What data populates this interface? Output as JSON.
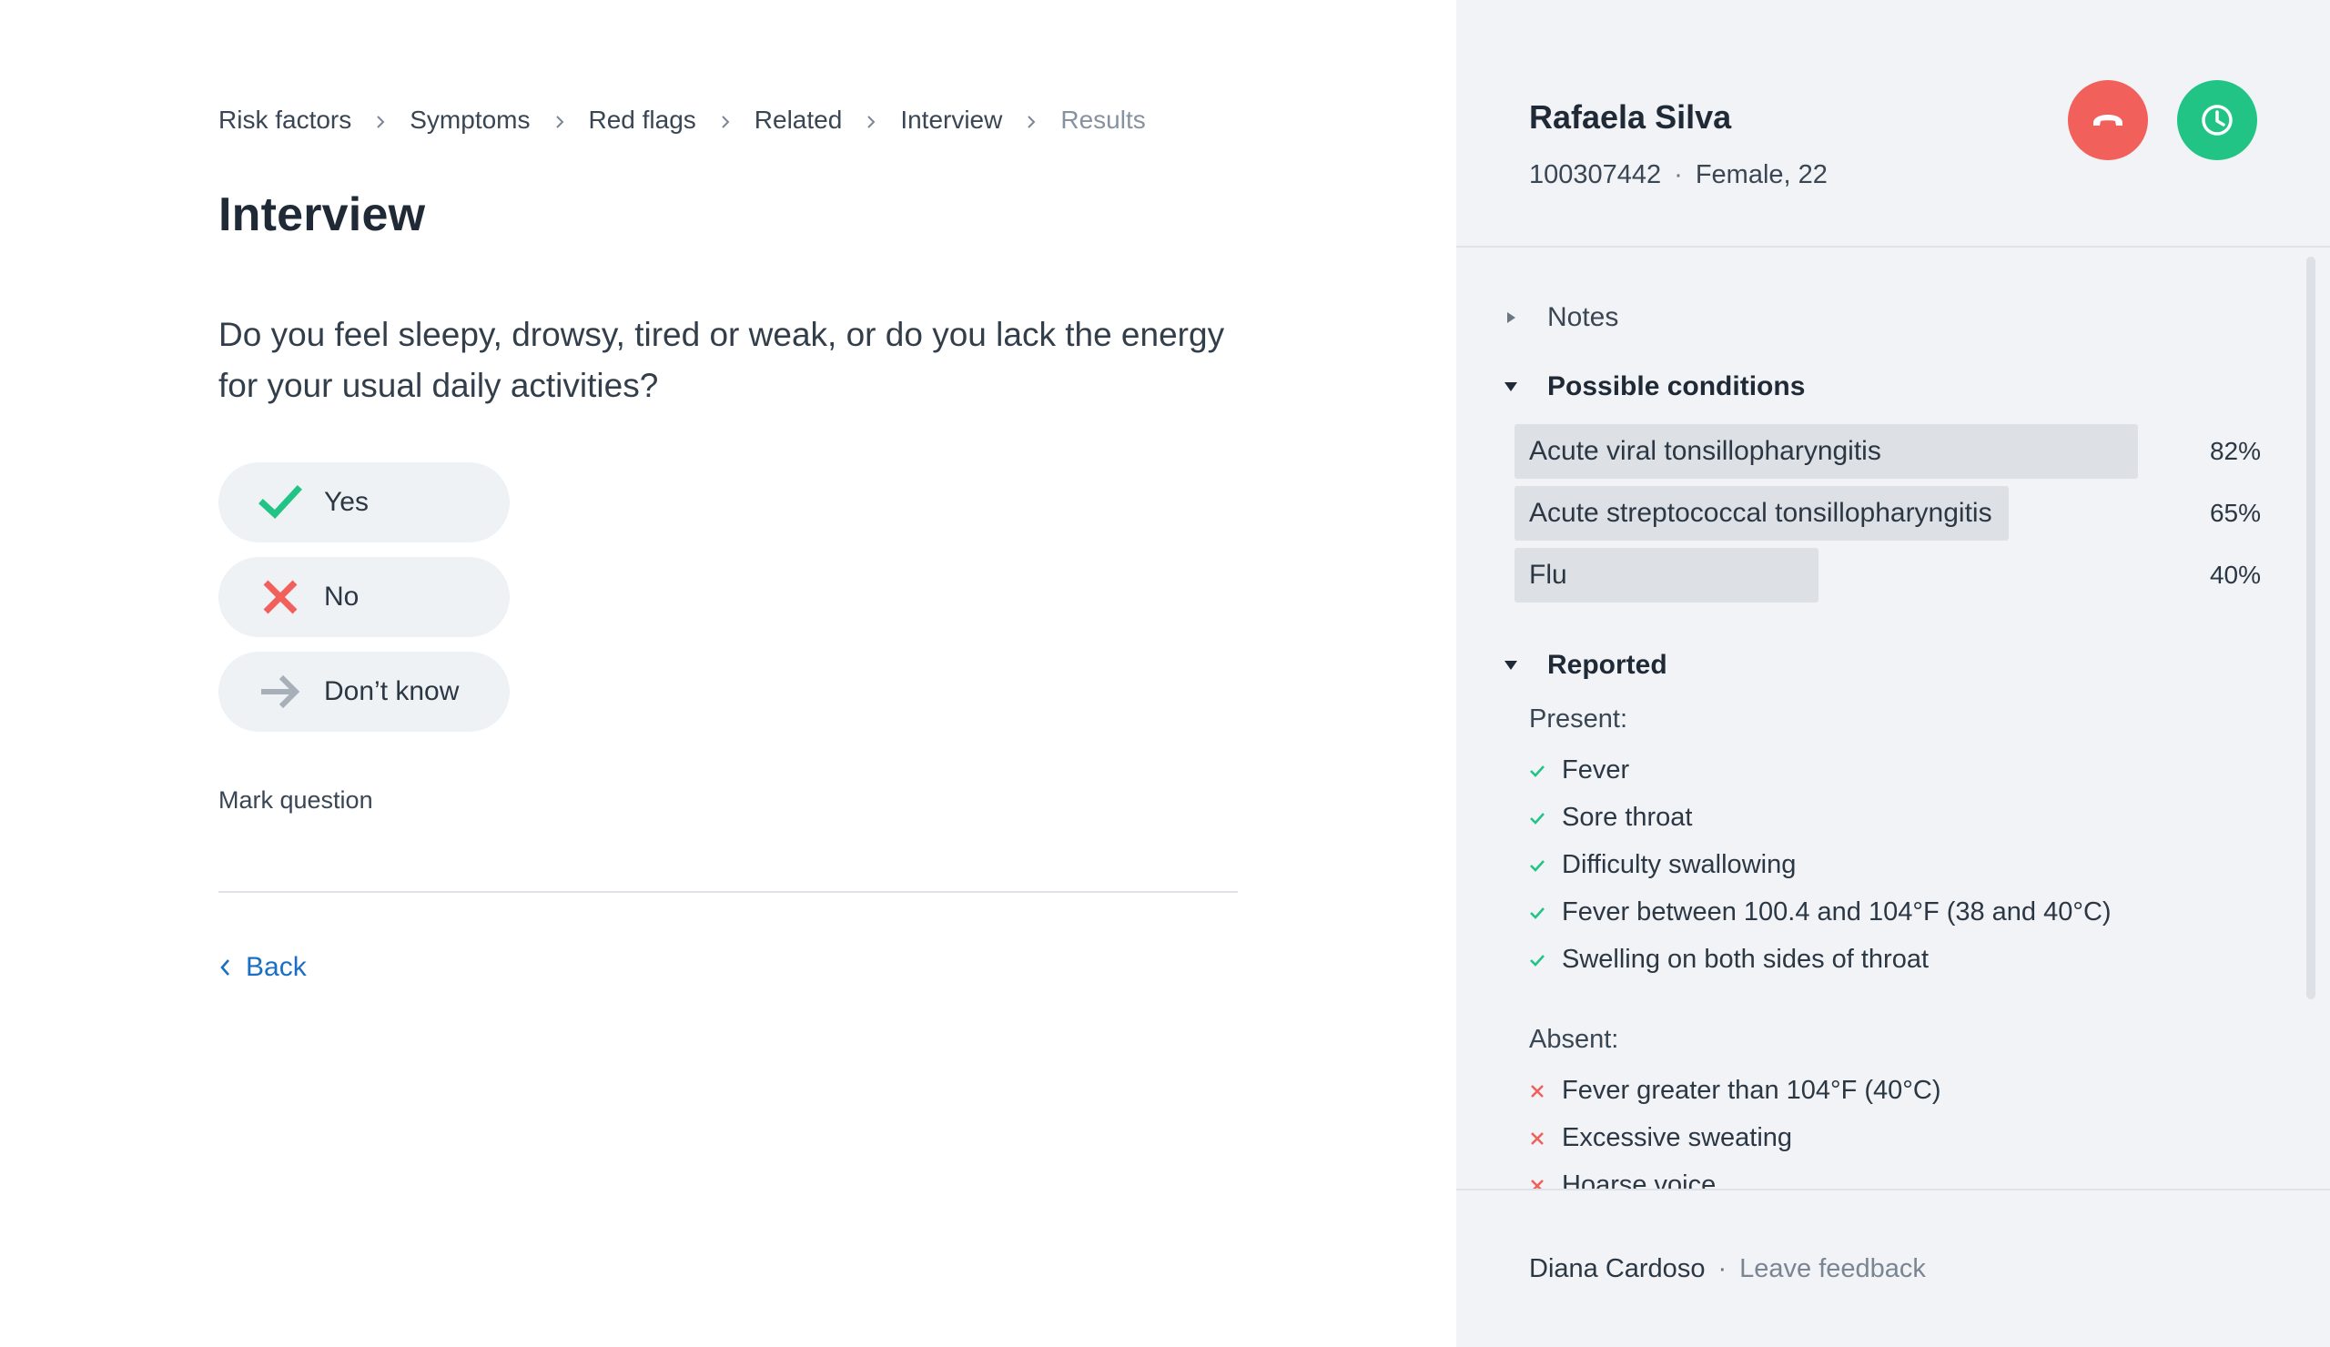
{
  "breadcrumb": {
    "items": [
      {
        "label": "Risk factors"
      },
      {
        "label": "Symptoms"
      },
      {
        "label": "Red flags"
      },
      {
        "label": "Related"
      },
      {
        "label": "Interview"
      },
      {
        "label": "Results"
      }
    ]
  },
  "main": {
    "title": "Interview",
    "question": "Do you feel sleepy, drowsy, tired or weak, or do you lack the energy for your usual daily activities?",
    "answers": {
      "yes": "Yes",
      "no": "No",
      "dont_know": "Don’t know"
    },
    "mark_question": "Mark question",
    "back": "Back"
  },
  "patient": {
    "name": "Rafaela Silva",
    "id": "100307442",
    "separator": "·",
    "demographics": "Female, 22"
  },
  "panel": {
    "notes_label": "Notes",
    "conditions_label": "Possible conditions",
    "conditions": [
      {
        "name": "Acute viral tonsillopharyngitis",
        "percent": "82%",
        "fraction": 0.82
      },
      {
        "name": "Acute streptococcal tonsillopharyngitis",
        "percent": "65%",
        "fraction": 0.65
      },
      {
        "name": "Flu",
        "percent": "40%",
        "fraction": 0.4
      }
    ],
    "reported_label": "Reported",
    "present_label": "Present:",
    "present": [
      "Fever",
      "Sore throat",
      "Difficulty swallowing",
      "Fever between 100.4 and 104°F (38 and 40°C)",
      "Swelling on both sides of throat"
    ],
    "absent_label": "Absent:",
    "absent": [
      "Fever greater than 104°F (40°C)",
      "Excessive sweating",
      "Hoarse voice"
    ]
  },
  "footer": {
    "agent": "Diana Cardoso",
    "separator": "·",
    "feedback": "Leave feedback"
  },
  "colors": {
    "accent_link": "#1a6fc4",
    "hangup": "#f2605b",
    "clock": "#22c485",
    "check": "#22c485",
    "cross": "#f2605b",
    "panel_bg": "#f1f3f6"
  },
  "icons": {
    "yes": "check-icon",
    "no": "cross-icon",
    "dont_know": "arrow-right-icon",
    "hangup": "phone-hangup-icon",
    "clock": "clock-icon"
  }
}
